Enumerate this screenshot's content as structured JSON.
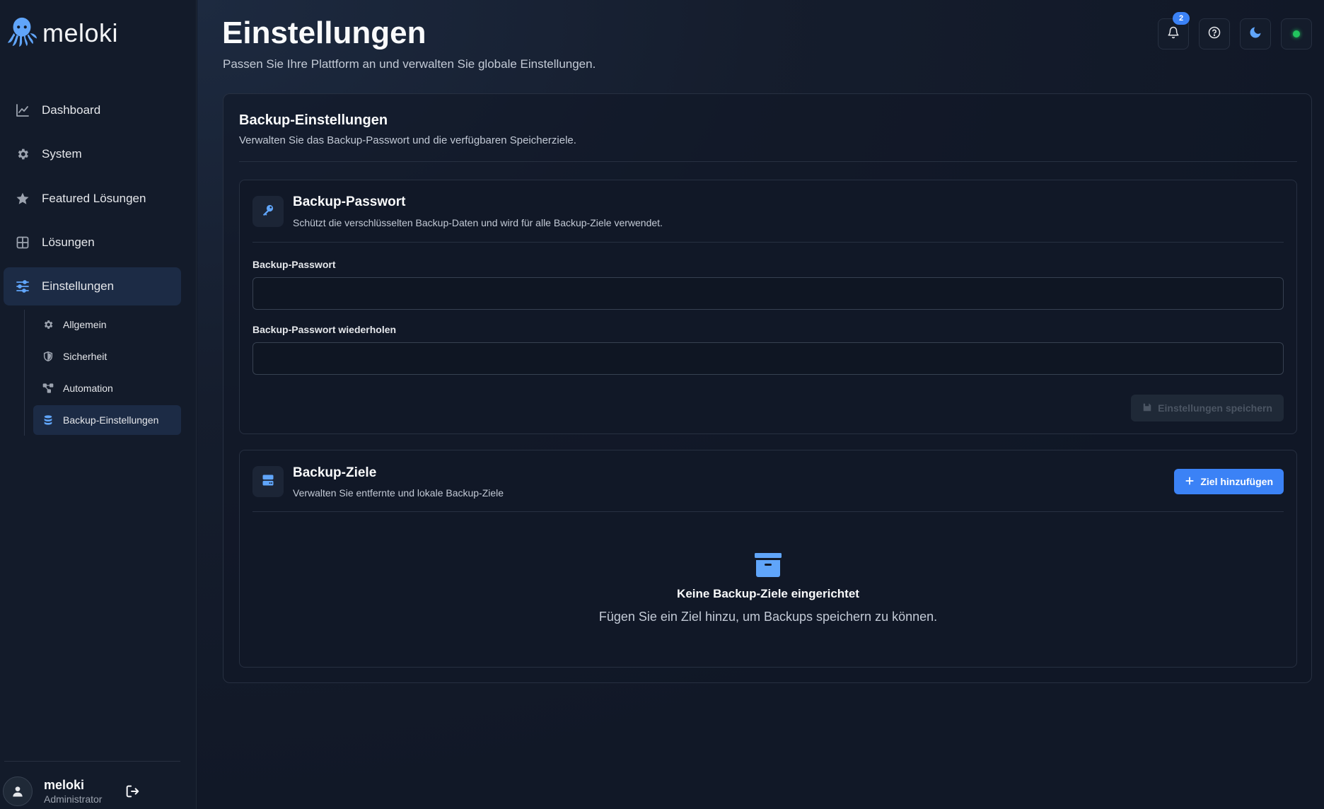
{
  "brand": {
    "name": "meloki"
  },
  "sidebar": {
    "items": [
      {
        "label": "Dashboard",
        "icon": "chart-line-icon"
      },
      {
        "label": "System",
        "icon": "gear-icon"
      },
      {
        "label": "Featured Lösungen",
        "icon": "star-icon"
      },
      {
        "label": "Lösungen",
        "icon": "grid-icon"
      },
      {
        "label": "Einstellungen",
        "icon": "sliders-icon",
        "active": true
      }
    ],
    "subitems": [
      {
        "label": "Allgemein",
        "icon": "gear-icon"
      },
      {
        "label": "Sicherheit",
        "icon": "shield-icon"
      },
      {
        "label": "Automation",
        "icon": "nodes-icon"
      },
      {
        "label": "Backup-Einstellungen",
        "icon": "database-icon",
        "active": true
      }
    ]
  },
  "user": {
    "name": "meloki",
    "role": "Administrator"
  },
  "header": {
    "title": "Einstellungen",
    "subtitle": "Passen Sie Ihre Plattform an und verwalten Sie globale Einstellungen.",
    "notification_count": "2"
  },
  "panel": {
    "title": "Backup-Einstellungen",
    "subtitle": "Verwalten Sie das Backup-Passwort und die verfügbaren Speicherziele."
  },
  "password_card": {
    "title": "Backup-Passwort",
    "subtitle": "Schützt die verschlüsselten Backup-Daten und wird für alle Backup-Ziele verwendet.",
    "field1_label": "Backup-Passwort",
    "field1_value": "",
    "field2_label": "Backup-Passwort wiederholen",
    "field2_value": "",
    "save_label": "Einstellungen speichern"
  },
  "targets_card": {
    "title": "Backup-Ziele",
    "subtitle": "Verwalten Sie entfernte und lokale Backup-Ziele",
    "add_label": "Ziel hinzufügen",
    "empty_title": "Keine Backup-Ziele eingerichtet",
    "empty_subtitle": "Fügen Sie ein Ziel hinzu, um Backups speichern zu können."
  },
  "colors": {
    "accent": "#3b82f6",
    "background": "#111827",
    "status_online": "#22c55e"
  }
}
